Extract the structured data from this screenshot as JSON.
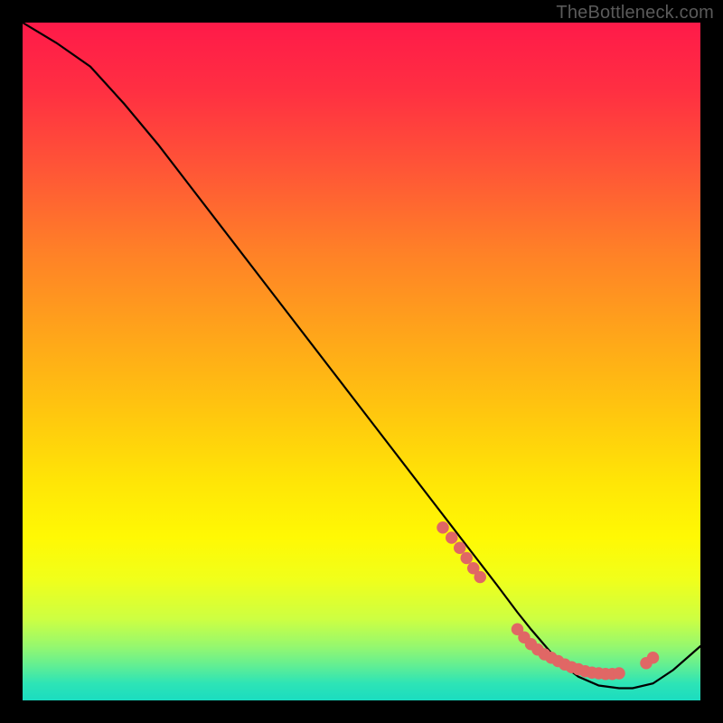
{
  "watermark": "TheBottleneck.com",
  "colors": {
    "dot": "#e06765",
    "curve": "#000000",
    "bg": "#000000"
  },
  "chart_data": {
    "type": "line",
    "title": "",
    "xlabel": "",
    "ylabel": "",
    "xlim": [
      0,
      100
    ],
    "ylim": [
      0,
      100
    ],
    "grid": false,
    "legend": false,
    "series": [
      {
        "name": "curve",
        "x": [
          0,
          5,
          10,
          15,
          20,
          25,
          30,
          35,
          40,
          45,
          50,
          55,
          60,
          65,
          70,
          73,
          75,
          78,
          80,
          82,
          85,
          88,
          90,
          93,
          96,
          100
        ],
        "y": [
          100,
          97,
          93.5,
          88,
          82,
          75.5,
          69,
          62.5,
          56,
          49.5,
          43,
          36.5,
          30,
          23.5,
          17,
          13,
          10.5,
          7,
          5,
          3.5,
          2.2,
          1.8,
          1.8,
          2.5,
          4.5,
          8
        ]
      }
    ],
    "highlight_points": {
      "name": "dots",
      "x": [
        62,
        63.3,
        64.5,
        65.5,
        66.5,
        67.5,
        73,
        74,
        75,
        76,
        77,
        78,
        79,
        80,
        81,
        82,
        83,
        84,
        85,
        86,
        87,
        88,
        92,
        93
      ],
      "y": [
        25.5,
        24,
        22.5,
        21,
        19.5,
        18.2,
        10.5,
        9.3,
        8.3,
        7.5,
        6.8,
        6.3,
        5.8,
        5.3,
        4.9,
        4.6,
        4.3,
        4.1,
        4.0,
        3.9,
        3.9,
        4.0,
        5.5,
        6.3
      ]
    }
  }
}
